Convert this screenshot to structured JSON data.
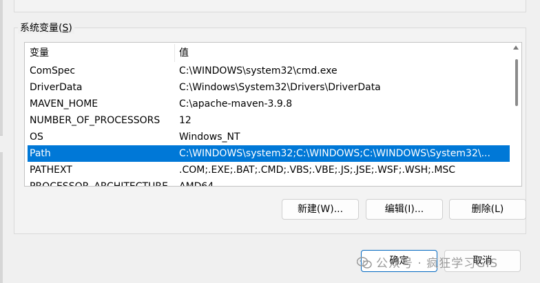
{
  "group": {
    "label_text": "系统变量(",
    "label_accel": "S",
    "label_end": ")"
  },
  "table": {
    "columns": [
      "变量",
      "值"
    ],
    "rows": [
      {
        "name": "ComSpec",
        "value": "C:\\WINDOWS\\system32\\cmd.exe"
      },
      {
        "name": "DriverData",
        "value": "C:\\Windows\\System32\\Drivers\\DriverData"
      },
      {
        "name": "MAVEN_HOME",
        "value": "C:\\apache-maven-3.9.8"
      },
      {
        "name": "NUMBER_OF_PROCESSORS",
        "value": "12"
      },
      {
        "name": "OS",
        "value": "Windows_NT"
      },
      {
        "name": "Path",
        "value": "C:\\WINDOWS\\system32;C:\\WINDOWS;C:\\WINDOWS\\System32\\..."
      },
      {
        "name": "PATHEXT",
        "value": ".COM;.EXE;.BAT;.CMD;.VBS;.VBE;.JS;.JSE;.WSF;.WSH;.MSC"
      },
      {
        "name": "PROCESSOR_ARCHITECTURE",
        "value": "AMD64"
      }
    ],
    "selected_index": 5
  },
  "buttons": {
    "new": "新建(W)...",
    "edit": "编辑(I)...",
    "delete": "删除(L)",
    "ok": "确定",
    "cancel": "取消"
  },
  "watermark": {
    "text": "公众号 · 疯狂学习GIS"
  },
  "colors": {
    "selection": "#0078d7",
    "primary_border": "#0067c0"
  }
}
